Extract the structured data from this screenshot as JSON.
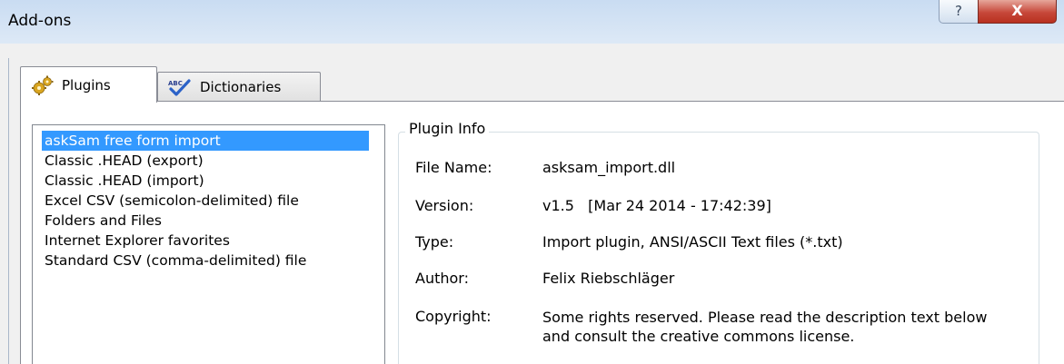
{
  "window": {
    "title": "Add-ons",
    "help_glyph": "?",
    "close_glyph": "X"
  },
  "tabs": [
    {
      "label": "Plugins",
      "icon": "gears-icon",
      "active": true
    },
    {
      "label": "Dictionaries",
      "icon": "spellcheck-icon",
      "active": false
    }
  ],
  "plugin_list": {
    "items": [
      "askSam free form import",
      "Classic .HEAD (export)",
      "Classic .HEAD (import)",
      "Excel CSV (semicolon-delimited) file",
      "Folders and Files",
      "Internet Explorer favorites",
      "Standard CSV (comma-delimited) file"
    ],
    "selected_index": 0
  },
  "plugin_info": {
    "legend": "Plugin Info",
    "file_name_label": "File Name:",
    "file_name": "asksam_import.dll",
    "version_label": "Version:",
    "version": "v1.5   [Mar 24 2014 - 17:42:39]",
    "type_label": "Type:",
    "type": "Import plugin, ANSI/ASCII Text files (*.txt)",
    "author_label": "Author:",
    "author": "Felix Riebschläger",
    "copyright_label": "Copyright:",
    "copyright": "Some rights reserved. Please read the description text below and consult the creative commons license."
  },
  "colors": {
    "selection": "#3399ff",
    "close_button": "#c7483a"
  }
}
